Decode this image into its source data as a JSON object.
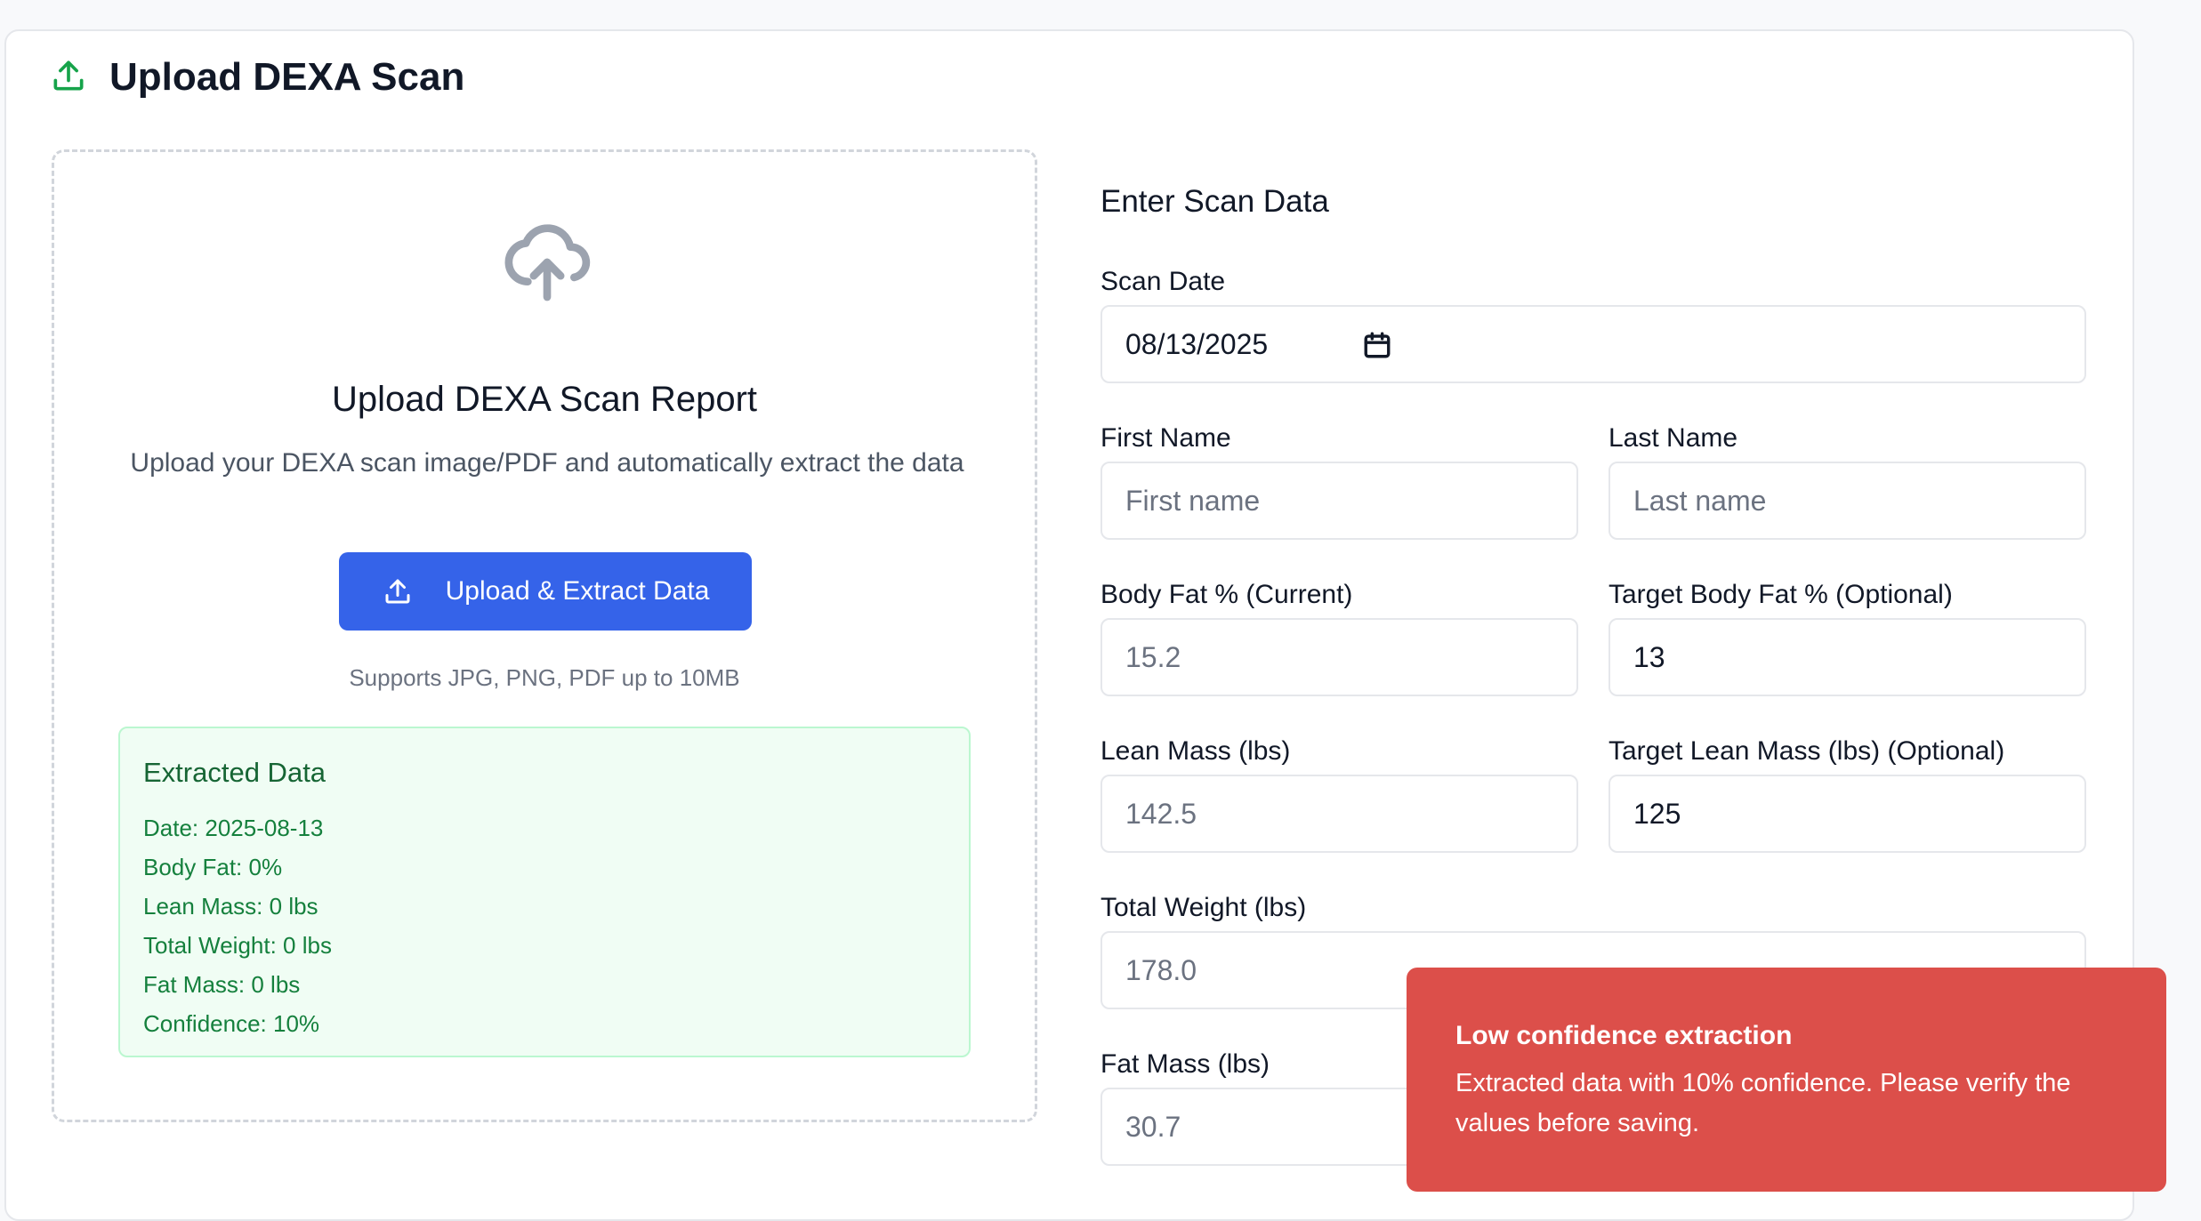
{
  "header": {
    "title": "Upload DEXA Scan",
    "icon": "upload-icon"
  },
  "upload": {
    "icon": "cloud-upload-icon",
    "title": "Upload DEXA Scan Report",
    "description": "Upload your DEXA scan image/PDF and automatically extract the data",
    "button_label": "Upload & Extract Data",
    "supports": "Supports JPG, PNG, PDF up to 10MB"
  },
  "extracted": {
    "title": "Extracted Data",
    "items": [
      "Date: 2025-08-13",
      "Body Fat: 0%",
      "Lean Mass: 0 lbs",
      "Total Weight: 0 lbs",
      "Fat Mass: 0 lbs",
      "Confidence: 10%"
    ]
  },
  "form": {
    "title": "Enter Scan Data",
    "scan_date": {
      "label": "Scan Date",
      "value": "08/13/2025"
    },
    "first_name": {
      "label": "First Name",
      "placeholder": "First name"
    },
    "last_name": {
      "label": "Last Name",
      "placeholder": "Last name"
    },
    "body_fat": {
      "label": "Body Fat % (Current)",
      "placeholder": "15.2"
    },
    "target_body_fat": {
      "label": "Target Body Fat % (Optional)",
      "value": "13"
    },
    "lean_mass": {
      "label": "Lean Mass (lbs)",
      "placeholder": "142.5"
    },
    "target_lean_mass": {
      "label": "Target Lean Mass (lbs) (Optional)",
      "value": "125"
    },
    "total_weight": {
      "label": "Total Weight (lbs)",
      "placeholder": "178.0"
    },
    "fat_mass": {
      "label": "Fat Mass (lbs)",
      "placeholder": "30.7"
    }
  },
  "toast": {
    "title": "Low confidence extraction",
    "message": "Extracted data with 10% confidence. Please verify the values before saving.",
    "color": "#dc4f4a"
  },
  "colors": {
    "accent": "#3563e9",
    "success_bg": "#f0fdf4",
    "success_text": "#15803d",
    "header_icon": "#16a34a"
  }
}
